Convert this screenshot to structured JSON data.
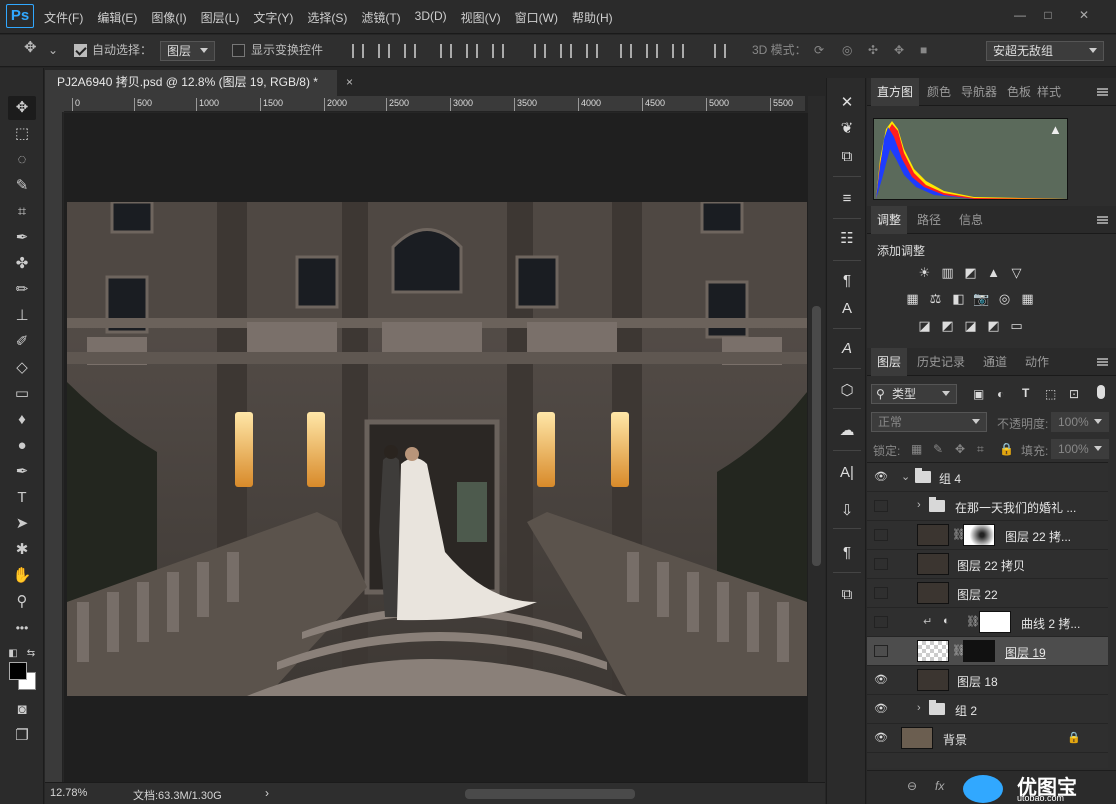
{
  "app": {
    "logo": "Ps"
  },
  "menu": [
    "文件(F)",
    "编辑(E)",
    "图像(I)",
    "图层(L)",
    "文字(Y)",
    "选择(S)",
    "滤镜(T)",
    "3D(D)",
    "视图(V)",
    "窗口(W)",
    "帮助(H)"
  ],
  "window_controls": {
    "minimize": "—",
    "maximize": "□",
    "close": "✕"
  },
  "options": {
    "auto_select_label": "自动选择：",
    "auto_select_value": "图层",
    "show_transform_label": "显示变换控件",
    "mode_3d_label": "3D 模式：",
    "workspace": "安超无敌组"
  },
  "document": {
    "tab_title": "PJ2A6940 拷贝.psd @ 12.8% (图层 19, RGB/8) *",
    "close": "×",
    "ruler_ticks": [
      "0",
      "500",
      "1000",
      "1500",
      "2000",
      "2500",
      "3000",
      "3500",
      "4000",
      "4500",
      "5000",
      "5500"
    ],
    "zoom": "12.78%",
    "doc_size": "文档:63.3M/1.30G",
    "status_arrow": "›"
  },
  "panels": {
    "top_tabs": [
      "直方图",
      "颜色",
      "导航器",
      "色板",
      "样式"
    ],
    "mid_tabs": [
      "调整",
      "路径",
      "信息"
    ],
    "add_adjustment": "添加调整",
    "adj_icons_row1": [
      "☀",
      "▥",
      "◩",
      "▲",
      "▽"
    ],
    "adj_icons_row2": [
      "▦",
      "⚖",
      "◧",
      "📷",
      "◎",
      "▦"
    ],
    "adj_icons_row3": [
      "◪",
      "◩",
      "◪",
      "◩",
      "▭"
    ],
    "layer_tabs": [
      "图层",
      "历史记录",
      "通道",
      "动作"
    ],
    "filter_kind": "类型",
    "blend_mode": "正常",
    "opacity_label": "不透明度:",
    "opacity_value": "100%",
    "lock_label": "锁定:",
    "fill_label": "填充:",
    "fill_value": "100%",
    "warning": "▲",
    "watermark_site": "优图宝",
    "watermark_url": "utobao.com",
    "footer_fx": "fx",
    "footer_link": "⊖"
  },
  "layers": [
    {
      "name": "组 4",
      "type": "group",
      "visible": true,
      "open": true
    },
    {
      "name": "在那一天我们的婚礼 ...",
      "type": "group",
      "visible": false,
      "open": false
    },
    {
      "name": "图层 22 拷...",
      "type": "layer-mask",
      "visible": false
    },
    {
      "name": "图层 22 拷贝",
      "type": "layer",
      "visible": false
    },
    {
      "name": "图层 22",
      "type": "layer",
      "visible": false
    },
    {
      "name": "曲线 2 拷...",
      "type": "adjustment",
      "visible": false
    },
    {
      "name": "图层 19",
      "type": "layer-mask",
      "visible": false,
      "selected": true
    },
    {
      "name": "图层 18",
      "type": "layer",
      "visible": true
    },
    {
      "name": "组 2",
      "type": "group",
      "visible": true,
      "open": false
    },
    {
      "name": "背景",
      "type": "background",
      "visible": true
    }
  ]
}
